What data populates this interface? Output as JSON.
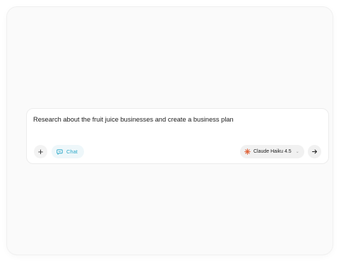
{
  "composer": {
    "prompt_text": "Research about the fruit juice businesses and create a business plan",
    "add_label": "+",
    "mode_label": "Chat",
    "model_label": "Claude Haiku 4.5",
    "model_chevron": "⌄"
  },
  "icons": {
    "add": "plus-icon",
    "mode": "chat-bubble-icon",
    "model": "claude-spark-icon",
    "send": "arrow-right-icon"
  },
  "colors": {
    "mode_accent": "#2fa9c9",
    "model_logo": "#e0663d"
  }
}
